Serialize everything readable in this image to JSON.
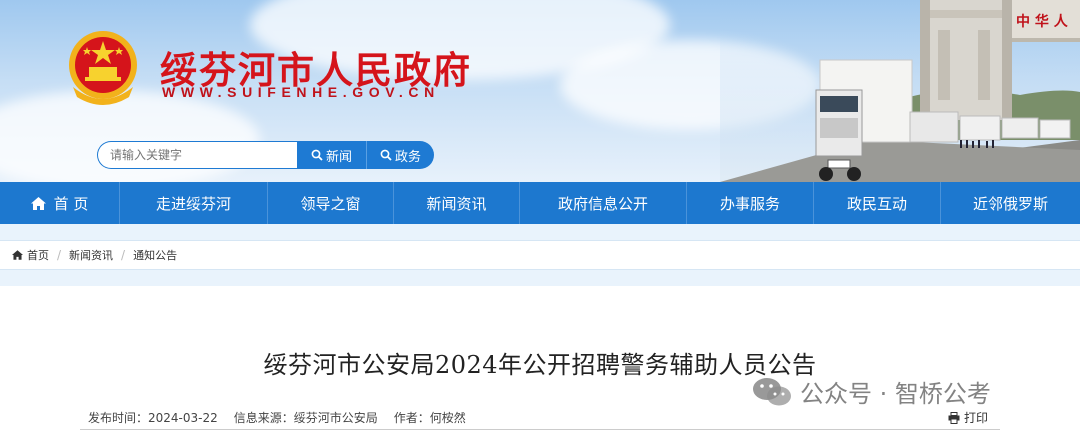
{
  "site": {
    "title": "绥芬河市人民政府",
    "url": "WWW.SUIFENHE.GOV.CN",
    "banner_text": "中 华 人"
  },
  "search": {
    "placeholder": "请输入关键字",
    "news_label": "新闻",
    "gov_label": "政务"
  },
  "nav": {
    "items": [
      {
        "label": "首 页",
        "icon": "home-icon"
      },
      {
        "label": "走进绥芬河"
      },
      {
        "label": "领导之窗"
      },
      {
        "label": "新闻资讯"
      },
      {
        "label": "政府信息公开"
      },
      {
        "label": "办事服务"
      },
      {
        "label": "政民互动"
      },
      {
        "label": "近邻俄罗斯"
      }
    ]
  },
  "breadcrumb": {
    "items": [
      "首页",
      "新闻资讯",
      "通知公告"
    ]
  },
  "article": {
    "title": "绥芬河市公安局2024年公开招聘警务辅助人员公告",
    "publish_time": "发布时间：2024-03-22",
    "source": "信息来源：绥芬河市公安局",
    "author": "作者：何桉然",
    "print_label": "打印"
  },
  "watermark": {
    "text": "公众号 · 智桥公考"
  },
  "colors": {
    "brand_red": "#d5141b",
    "nav_blue": "#1d78cf",
    "search_blue": "#1e7ad3"
  }
}
